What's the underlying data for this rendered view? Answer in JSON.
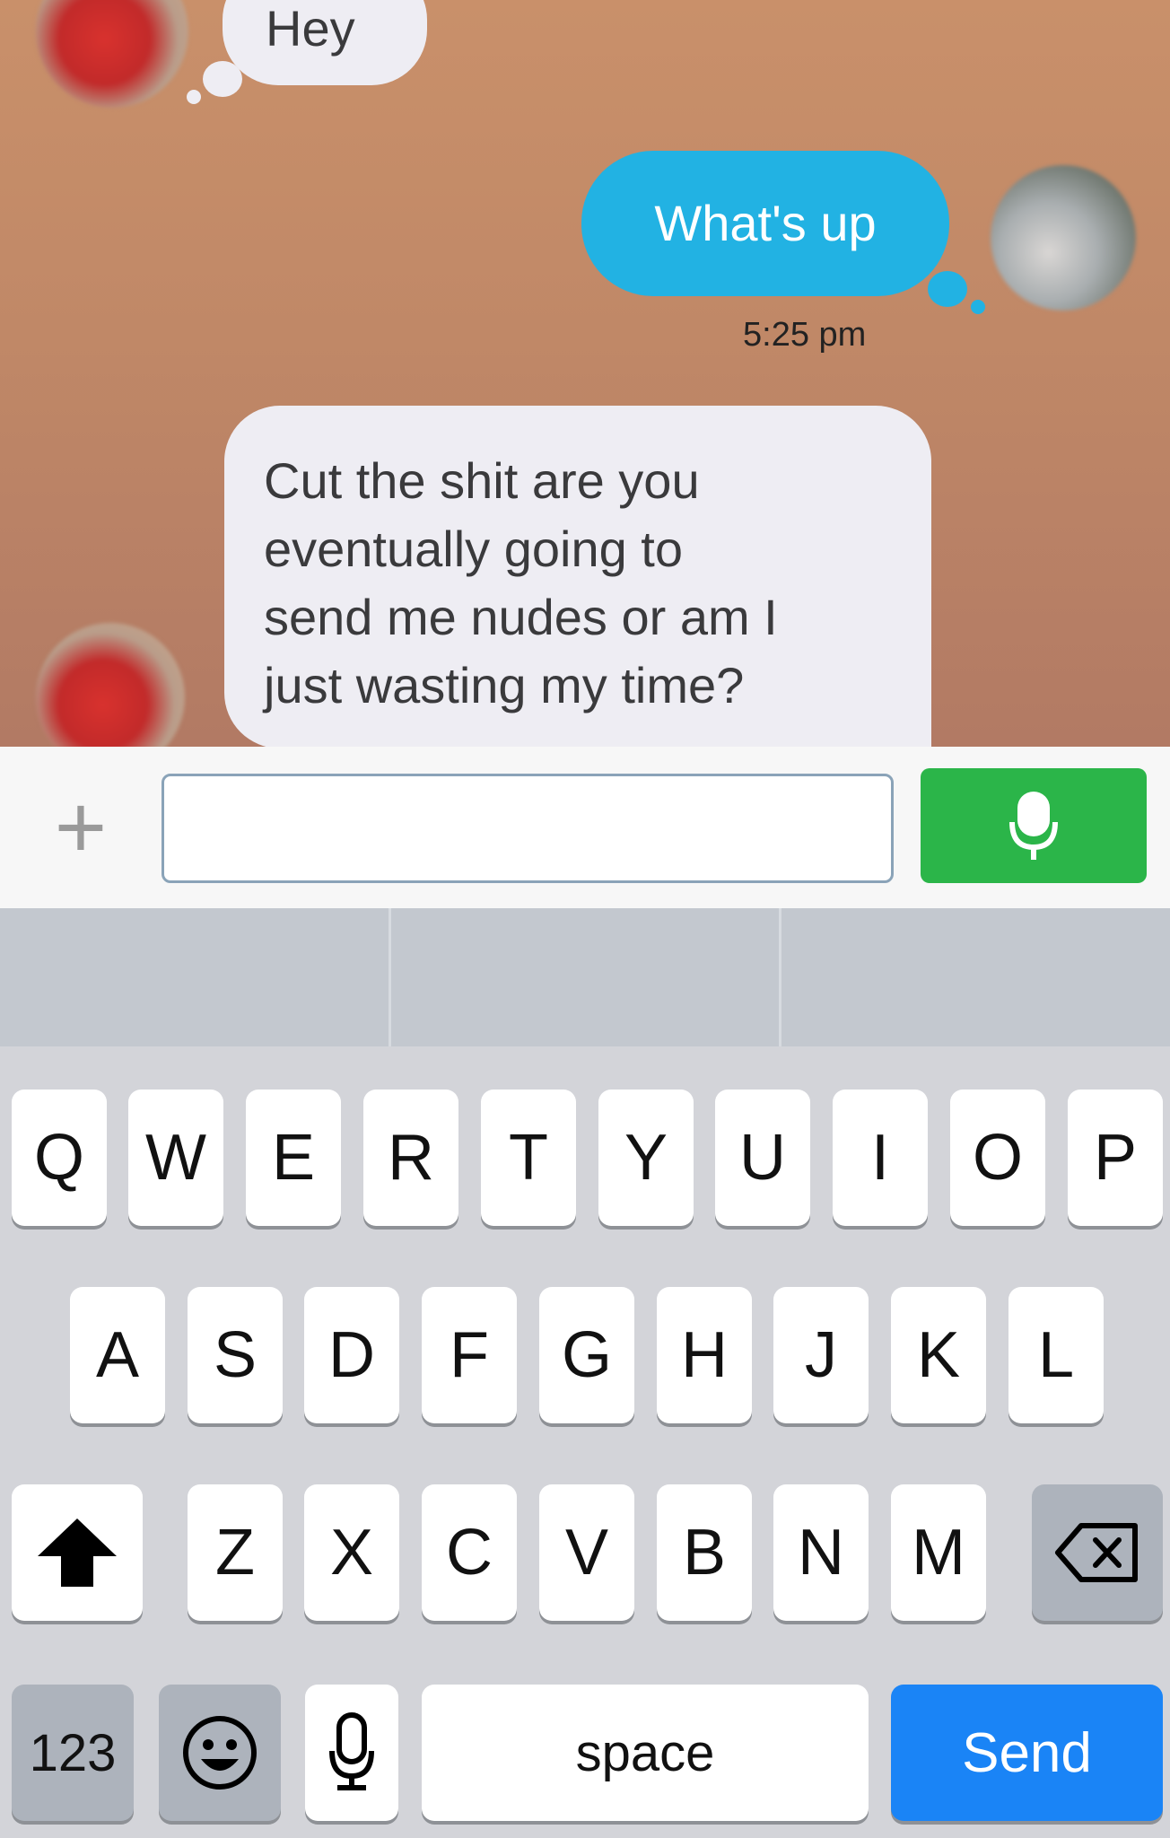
{
  "chat": {
    "messages": [
      {
        "sender": "them",
        "text": "Hey"
      },
      {
        "sender": "me",
        "text": "What's up",
        "time": "5:25 pm"
      },
      {
        "sender": "them",
        "lines": [
          "Cut the shit are you",
          "eventually going to",
          "send me nudes or am I",
          "just wasting my time?"
        ]
      }
    ]
  },
  "input": {
    "plus_icon": "plus-icon",
    "text_value": "",
    "mic_icon": "microphone-icon"
  },
  "keyboard": {
    "row1": [
      "Q",
      "W",
      "E",
      "R",
      "T",
      "Y",
      "U",
      "I",
      "O",
      "P"
    ],
    "row2": [
      "A",
      "S",
      "D",
      "F",
      "G",
      "H",
      "J",
      "K",
      "L"
    ],
    "row3": [
      "Z",
      "X",
      "C",
      "V",
      "B",
      "N",
      "M"
    ],
    "numbers_label": "123",
    "space_label": "space",
    "send_label": "Send",
    "shift_icon": "shift-arrow-icon",
    "delete_icon": "backspace-icon",
    "emoji_icon": "emoji-icon",
    "dictation_icon": "microphone-icon"
  },
  "colors": {
    "chat_bg": "#c08867",
    "my_bubble": "#22b2e3",
    "their_bubble": "#eeedf3",
    "mic_button": "#2bb549",
    "send_key": "#1a84f6"
  }
}
